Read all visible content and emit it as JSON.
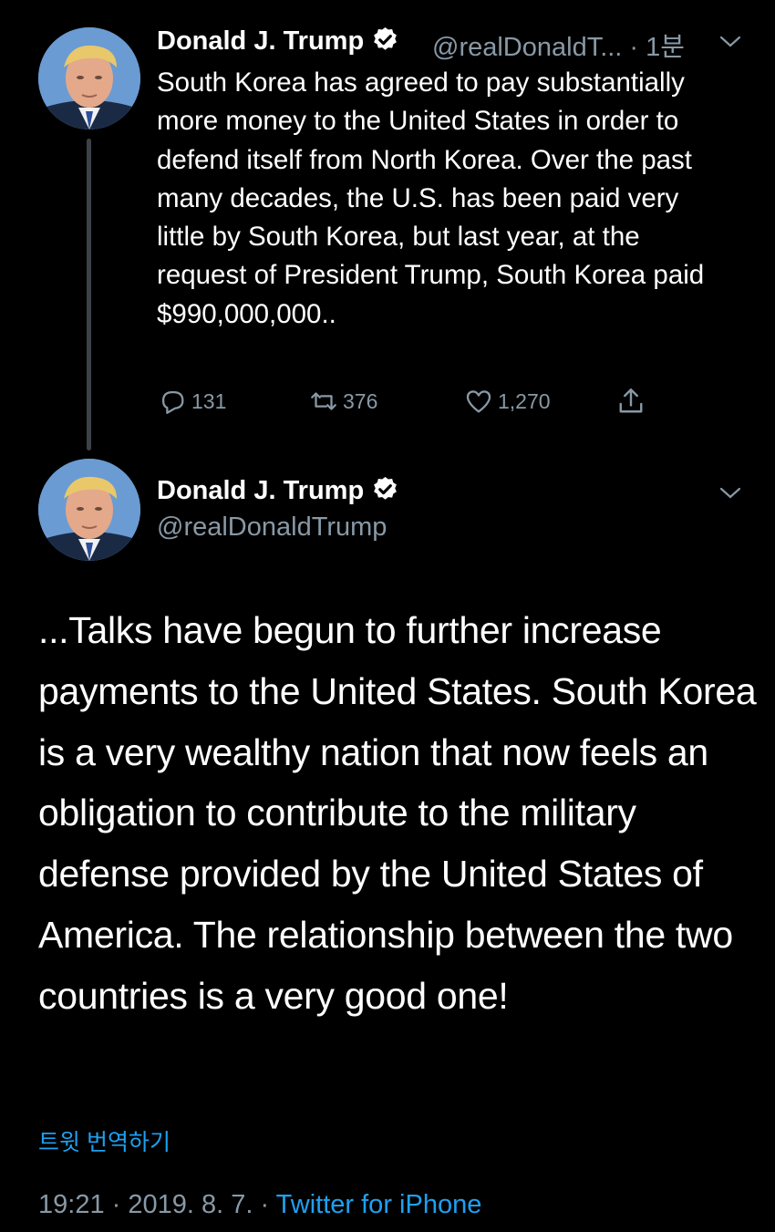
{
  "tweet1": {
    "author_name": "Donald J. Trump",
    "author_handle": "@realDonaldT...",
    "time_sep": " · ",
    "time": "1분",
    "text": "South Korea has agreed to pay substantially more money to the United States in order to defend itself from North Korea. Over the past many decades, the U.S. has been paid very little by South Korea, but last year, at the request of President Trump, South Korea paid $990,000,000..",
    "replies": "131",
    "retweets": "376",
    "likes": "1,270"
  },
  "tweet2": {
    "author_name": "Donald J. Trump",
    "author_handle": "@realDonaldTrump",
    "text": "...Talks have begun to further increase payments to the United States. South Korea is a very wealthy nation that now feels an obligation to contribute to the military defense provided by the United States of America. The relationship between the two countries is a very good one!",
    "translate_label": "트윗 번역하기",
    "time": "19:21",
    "sep1": " · ",
    "date": "2019. 8. 7.",
    "sep2": " · ",
    "source": "Twitter for iPhone"
  },
  "icons": {
    "verified": "verified-badge-icon",
    "reply": "reply-icon",
    "retweet": "retweet-icon",
    "like": "heart-icon",
    "share": "share-icon",
    "menu": "chevron-down-icon"
  },
  "colors": {
    "background": "#000000",
    "text": "#ffffff",
    "muted": "#8899a6",
    "link": "#1da1f2",
    "thread_line": "#3d4248"
  }
}
